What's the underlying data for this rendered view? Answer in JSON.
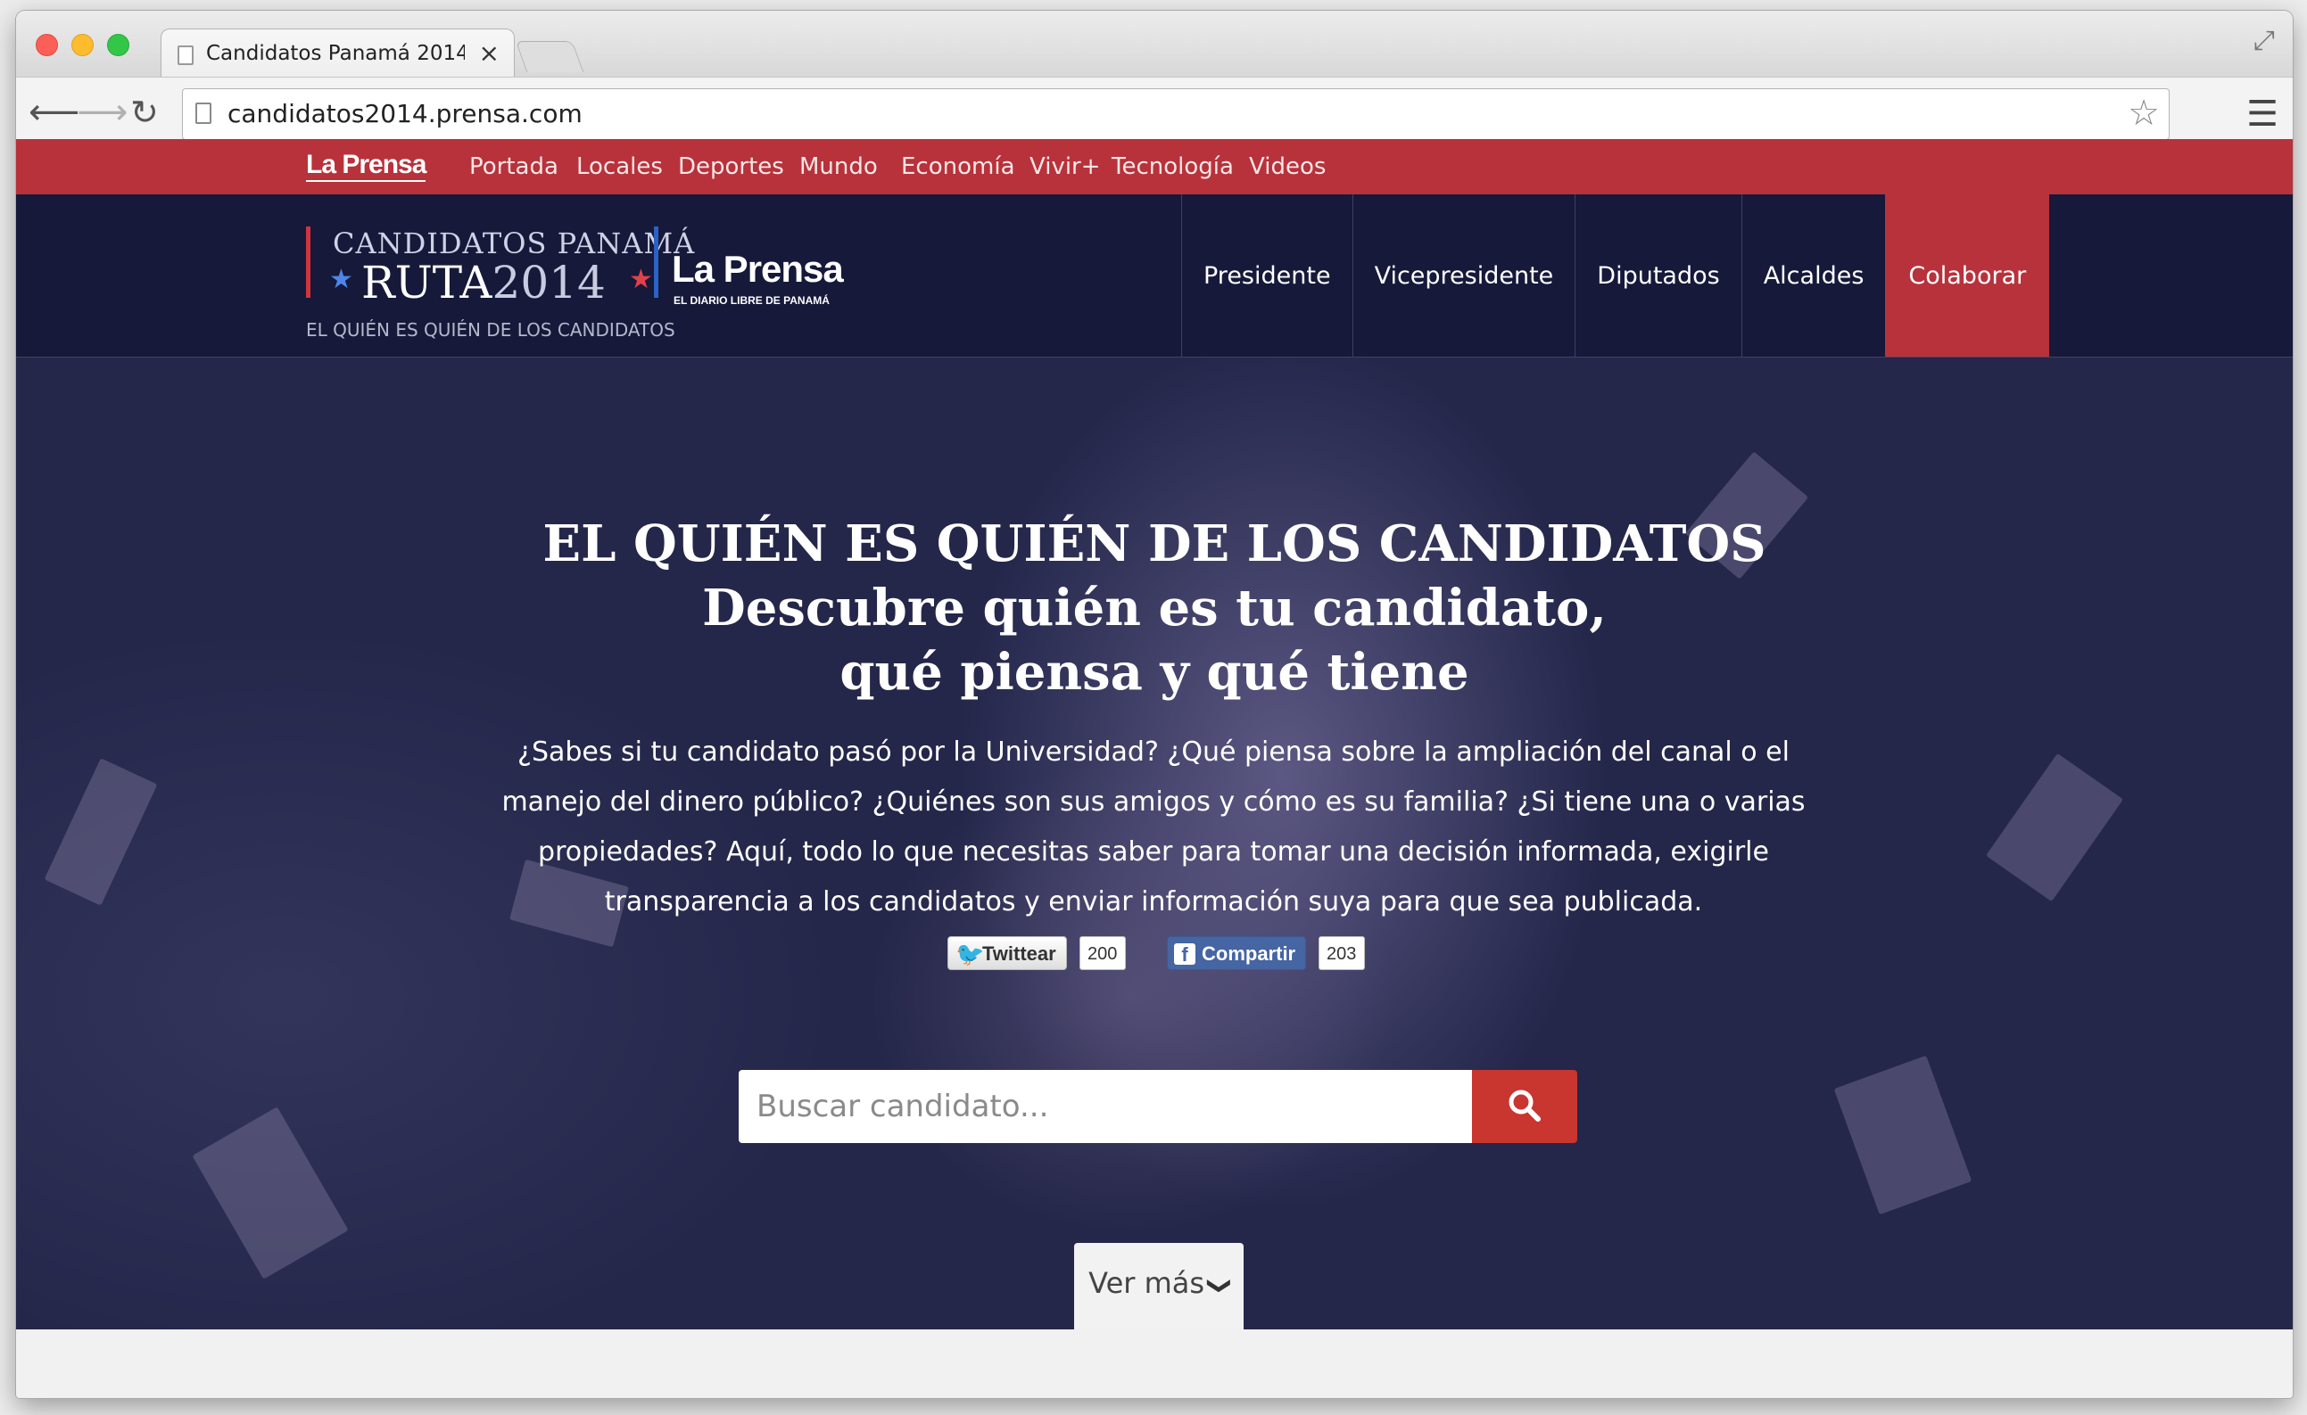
{
  "browser": {
    "tab_title": "Candidatos Panamá 2014",
    "tab_close": "×",
    "url": "candidatos2014.prensa.com",
    "icons": {
      "back": "arrow-left-icon",
      "forward": "arrow-right-icon",
      "reload": "reload-icon",
      "star": "star-icon",
      "menu": "hamburger-menu-icon",
      "fullscreen": "fullscreen-icon"
    }
  },
  "topbar": {
    "logo": "La Prensa",
    "links": [
      "Portada",
      "Locales",
      "Deportes",
      "Mundo",
      "Economía",
      "Vivir+",
      "Tecnología",
      "Videos"
    ]
  },
  "site_logo": {
    "line1": "CANDIDATOS PANAMÁ",
    "line2_bold": "RUTA",
    "line2_light": "2014",
    "tagline": "EL QUIÉN ES QUIÉN DE LOS CANDIDATOS",
    "publisher": "La Prensa",
    "publisher_sub": "EL DIARIO LIBRE DE PANAMÁ"
  },
  "main_nav": [
    "Presidente",
    "Vicepresidente",
    "Diputados",
    "Alcaldes",
    "Colaborar"
  ],
  "hero": {
    "title_line1": "EL QUIÉN ES QUIÉN DE LOS CANDIDATOS",
    "title_line2": "Descubre quién es tu candidato,",
    "title_line3": "qué piensa y qué tiene",
    "text": "¿Sabes si tu candidato pasó por la Universidad? ¿Qué piensa sobre la ampliación del canal o el manejo del dinero público? ¿Quiénes son sus amigos y cómo es su familia? ¿Si tiene una o varias propiedades? Aquí, todo lo que necesitas saber para tomar una decisión informada, exigirle transparencia a los candidatos y enviar información suya para que sea publicada."
  },
  "share": {
    "twitter_label": "Twittear",
    "twitter_count": "200",
    "facebook_label": "Compartir",
    "facebook_count": "203"
  },
  "search": {
    "placeholder": "Buscar candidato...",
    "button_icon": "search-icon"
  },
  "more": {
    "label": "Ver más"
  },
  "colors": {
    "brand_red": "#b8323b",
    "header_navy": "#121634",
    "search_button": "#c9352f"
  }
}
